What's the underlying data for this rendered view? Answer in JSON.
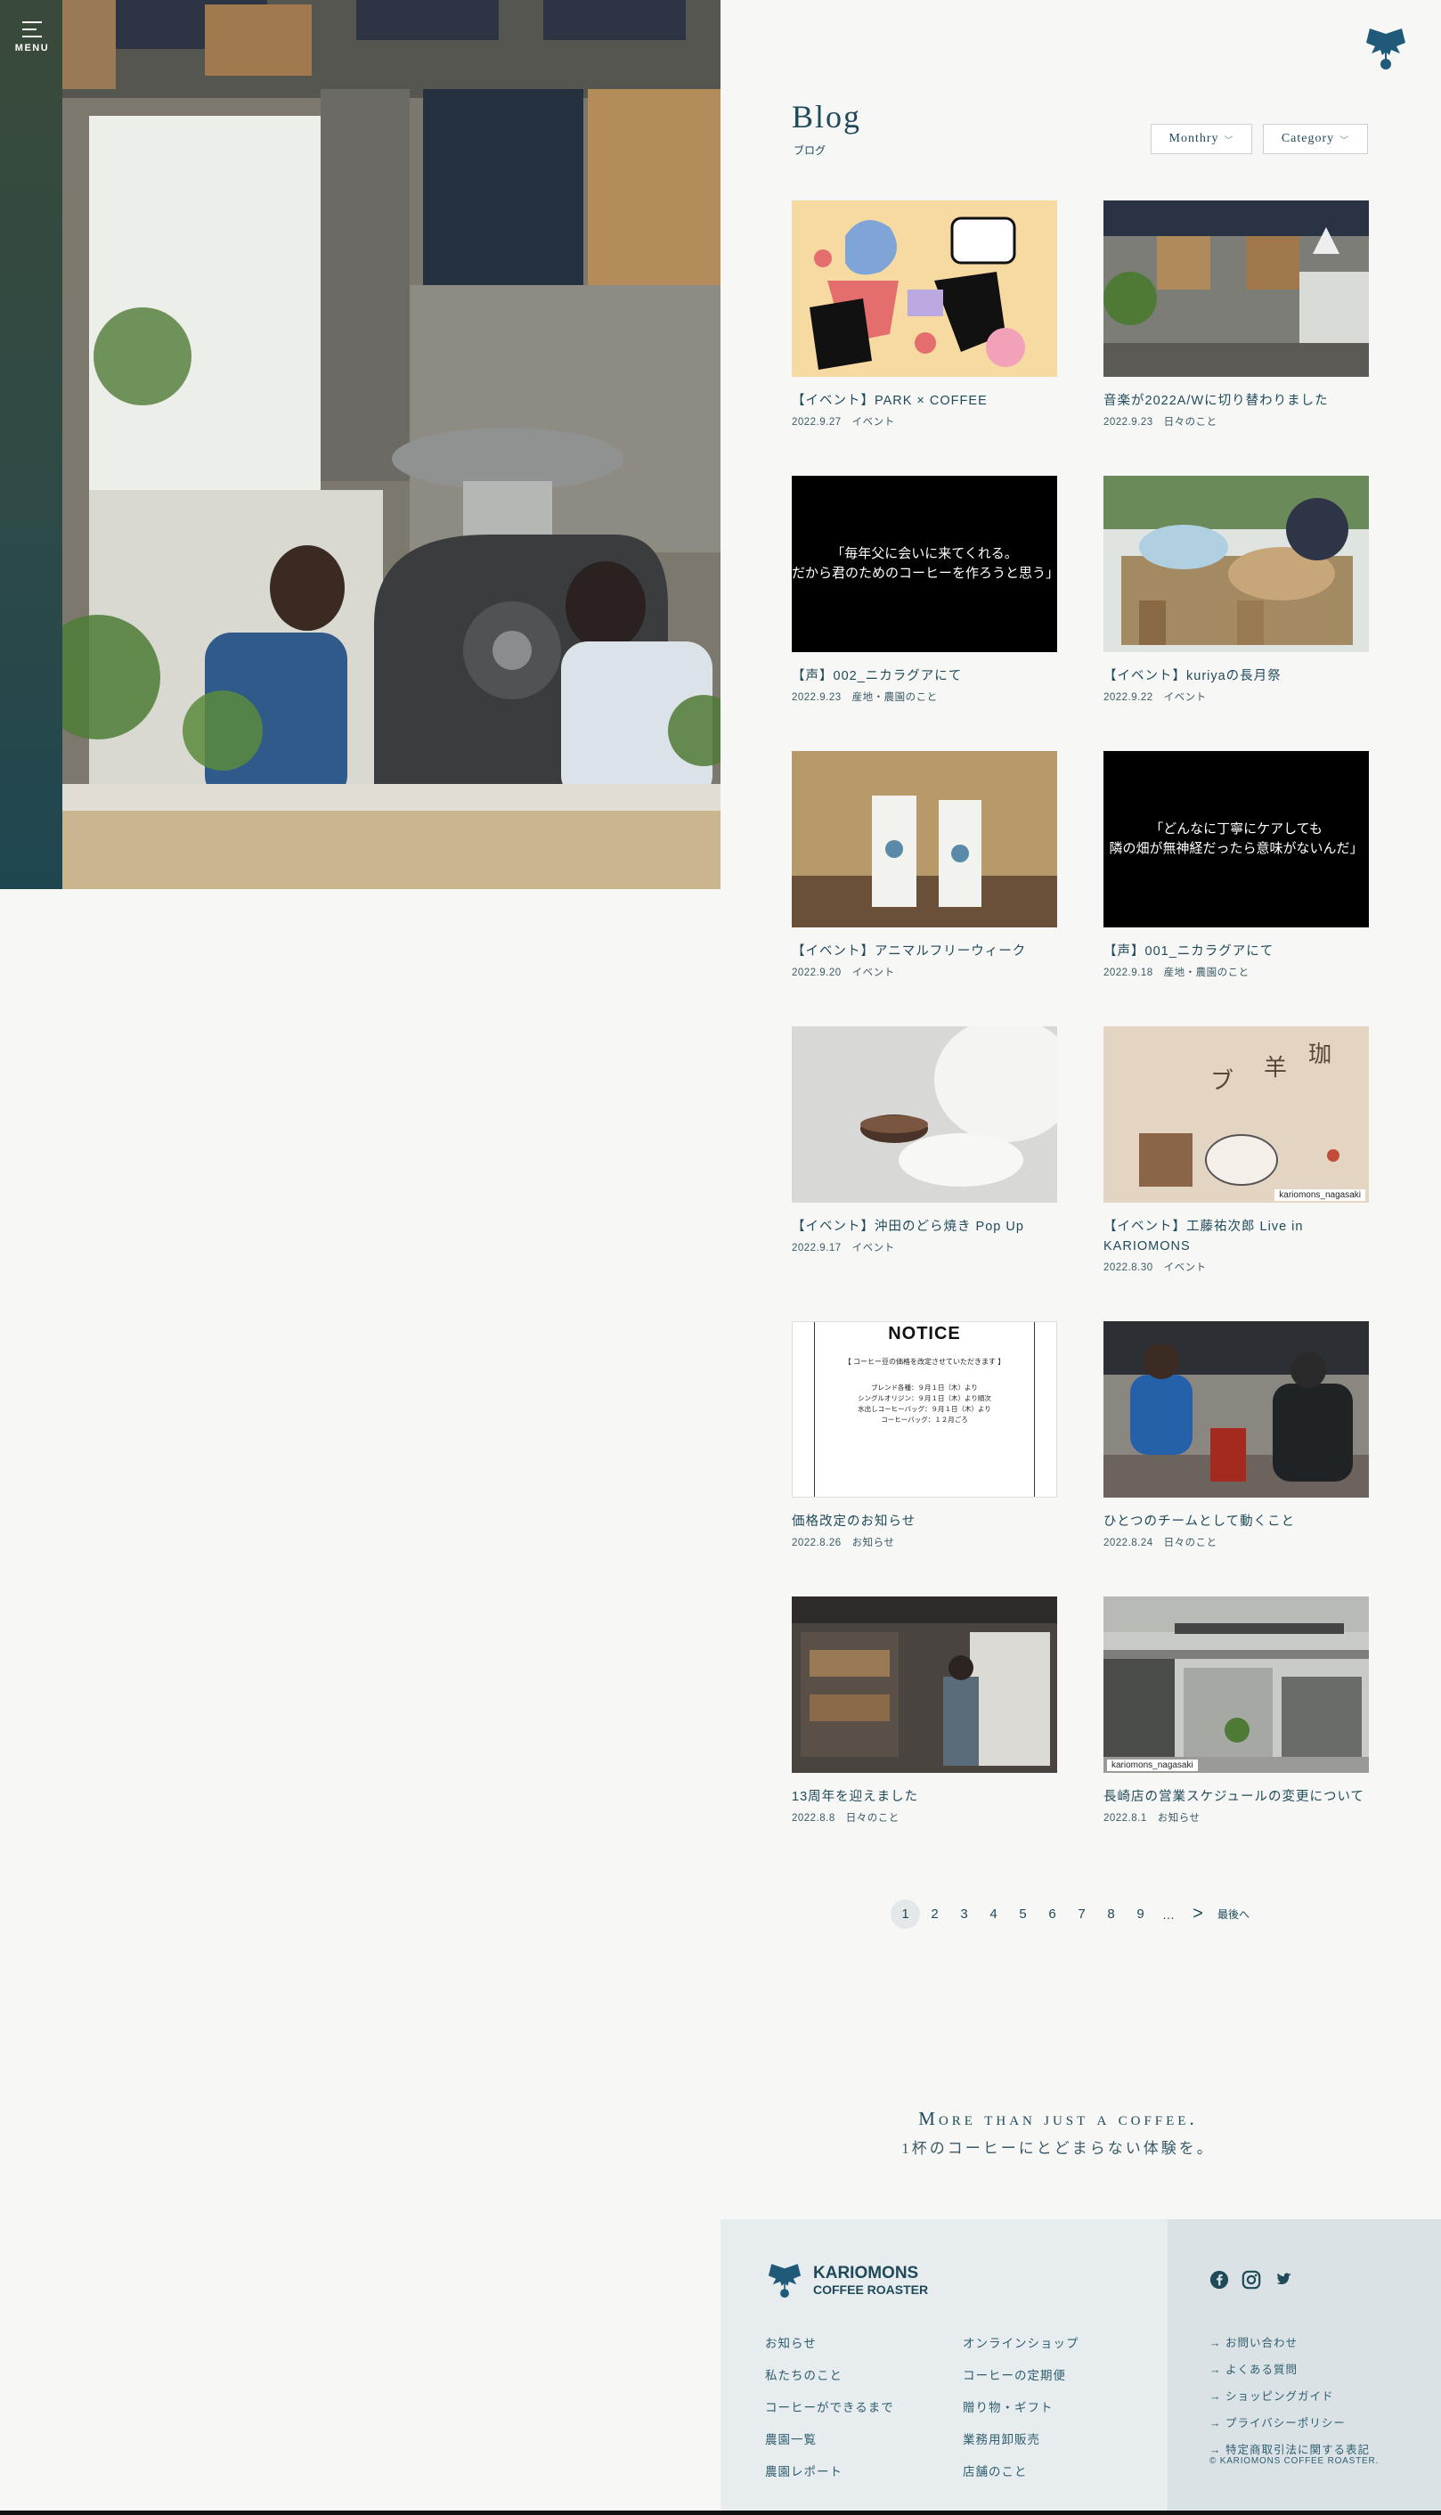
{
  "menu": {
    "label": "MENU"
  },
  "blog": {
    "title": "Blog",
    "subtitle": "ブログ"
  },
  "filters": {
    "monthly": "Monthry",
    "category": "Category"
  },
  "posts": [
    {
      "title": "【イベント】PARK × COFFEE",
      "date": "2022.9.27",
      "category": "イベント"
    },
    {
      "title": "音楽が2022A/Wに切り替わりました",
      "date": "2022.9.23",
      "category": "日々のこと"
    },
    {
      "title": "【声】002_ニカラグアにて",
      "date": "2022.9.23",
      "category": "産地・農園のこと",
      "quote": "「毎年父に会いに来てくれる。\nだから君のためのコーヒーを作ろうと思う」"
    },
    {
      "title": "【イベント】kuriyaの長月祭",
      "date": "2022.9.22",
      "category": "イベント"
    },
    {
      "title": "【イベント】アニマルフリーウィーク",
      "date": "2022.9.20",
      "category": "イベント"
    },
    {
      "title": "【声】001_ニカラグアにて",
      "date": "2022.9.18",
      "category": "産地・農園のこと",
      "quote": "「どんなに丁寧にケアしても\n隣の畑が無神経だったら意味がないんだ」"
    },
    {
      "title": "【イベント】沖田のどら焼き Pop Up",
      "date": "2022.9.17",
      "category": "イベント"
    },
    {
      "title": "【イベント】工藤祐次郎 Live in KARIOMONS",
      "date": "2022.8.30",
      "category": "イベント",
      "ig": "kariomons_nagasaki"
    },
    {
      "title": "価格改定のお知らせ",
      "date": "2022.8.26",
      "category": "お知らせ",
      "notice": {
        "heading": "NOTICE",
        "sub": "【 コーヒー豆の価格を改定させていただきます 】",
        "body": "ブレンド各種：９月１日（木）より\nシングルオリジン：９月１日（木）より順次\n水出しコーヒーバッグ：９月１日（木）より\nコーヒーバッグ：１２月ごろ"
      }
    },
    {
      "title": "ひとつのチームとして動くこと",
      "date": "2022.8.24",
      "category": "日々のこと"
    },
    {
      "title": "13周年を迎えました",
      "date": "2022.8.8",
      "category": "日々のこと"
    },
    {
      "title": "長崎店の営業スケジュールの変更について",
      "date": "2022.8.1",
      "category": "お知らせ",
      "ig": "kariomons_nagasaki"
    }
  ],
  "pagination": {
    "pages": [
      "1",
      "2",
      "3",
      "4",
      "5",
      "6",
      "7",
      "8",
      "9"
    ],
    "dots": "…",
    "next": ">",
    "last": "最後へ"
  },
  "tagline": {
    "en": "More than just a coffee.",
    "jp": "1杯のコーヒーにとどまらない体験を。"
  },
  "footer": {
    "brand_line1": "KARIOMONS",
    "brand_line2": "COFFEE ROASTER",
    "col1": [
      "お知らせ",
      "私たちのこと",
      "コーヒーができるまで",
      "農園一覧",
      "農園レポート"
    ],
    "col2": [
      "オンラインショップ",
      "コーヒーの定期便",
      "贈り物・ギフト",
      "業務用卸販売",
      "店舗のこと"
    ],
    "col3": [
      "お問い合わせ",
      "よくある質問",
      "ショッピングガイド",
      "プライバシーポリシー",
      "特定商取引法に関する表記"
    ],
    "copyright": "© KARIOMONS COFFEE ROASTER.",
    "social": [
      "facebook-icon",
      "instagram-icon",
      "twitter-icon"
    ]
  },
  "colors": {
    "accent": "#1f4a5a",
    "background": "#f7f7f6",
    "footer_bg": "#e7ecee",
    "footer_side_bg": "#dae2e5"
  }
}
